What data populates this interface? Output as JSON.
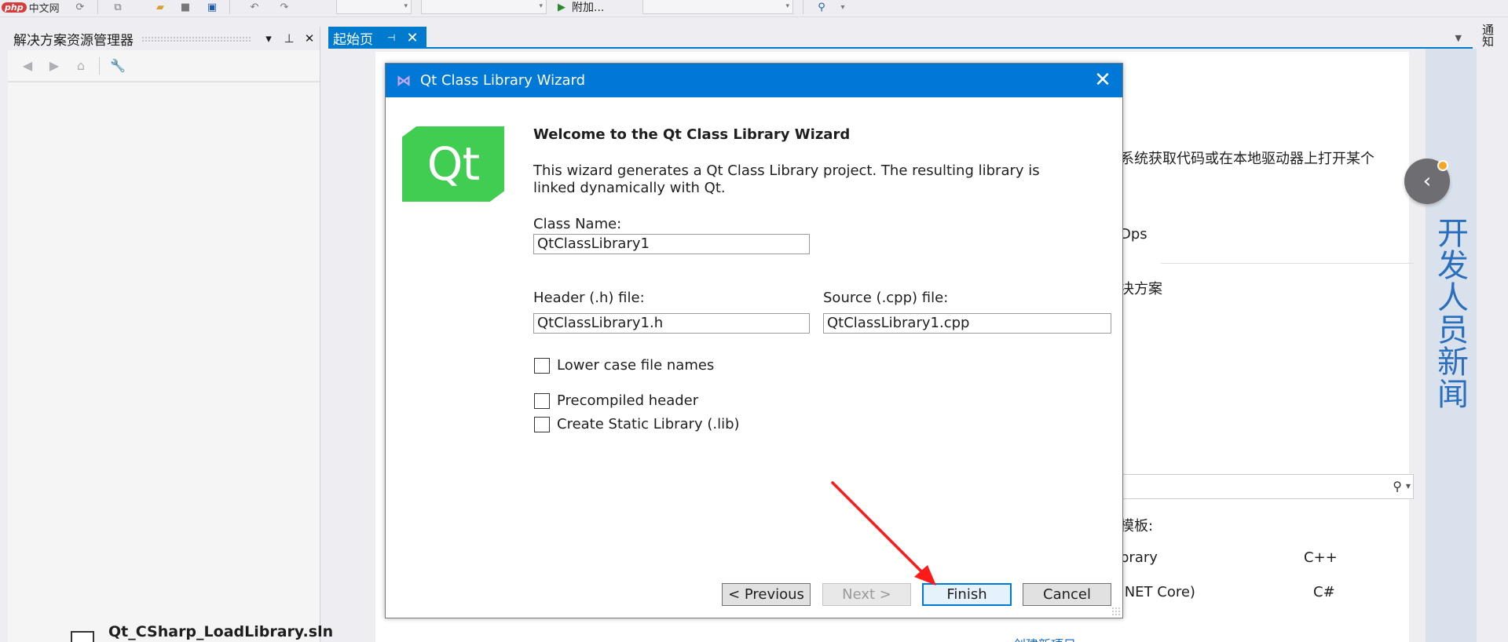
{
  "toolbar": {
    "brand_badge": "php",
    "brand_text": "中文网",
    "attach_label": "附加..."
  },
  "solution_explorer": {
    "title": "解决方案资源管理器",
    "dropdown_glyph": "▾",
    "pin_glyph": "⊥",
    "close_glyph": "✕"
  },
  "tabs": [
    {
      "label": "起始页",
      "pin_glyph": "⊣",
      "close_glyph": "✕"
    }
  ],
  "start_page": {
    "partial_text_1": "系统获取代码或在本地驱动器上打开某个",
    "partial_text_2": "Dps",
    "partial_text_3": "决方案",
    "partial_text_4": "模板:",
    "template_1_name": "brary",
    "template_1_lang": "C++",
    "template_2_name": ".NET Core)",
    "template_2_lang": "C#",
    "recent_solution": "Qt_CSharp_LoadLibrary.sln",
    "create_link": "创建新项目..."
  },
  "news": {
    "title": "开发人员新闻",
    "collapse_glyph": "‹"
  },
  "notifications": {
    "label": "通知"
  },
  "wizard": {
    "title": "Qt Class Library Wizard",
    "logo_text": "Qt",
    "heading": "Welcome to the Qt Class Library Wizard",
    "description": "This wizard generates a Qt Class Library project. The resulting library is linked dynamically with Qt.",
    "class_name_label": "Class Name:",
    "class_name_value": "QtClassLibrary1",
    "header_label": "Header (.h) file:",
    "header_value": "QtClassLibrary1.h",
    "source_label": "Source (.cpp) file:",
    "source_value": "QtClassLibrary1.cpp",
    "options": [
      {
        "label": "Lower case file names",
        "checked": false
      },
      {
        "label": "Precompiled header",
        "checked": false
      },
      {
        "label": "Create Static Library (.lib)",
        "checked": false
      }
    ],
    "buttons": {
      "previous": "< Previous",
      "next": "Next >",
      "finish": "Finish",
      "cancel": "Cancel"
    },
    "close_glyph": "✕"
  },
  "colors": {
    "accent": "#0078d7",
    "qt_green": "#41cd52",
    "annotation_red": "#ff1a1a"
  }
}
